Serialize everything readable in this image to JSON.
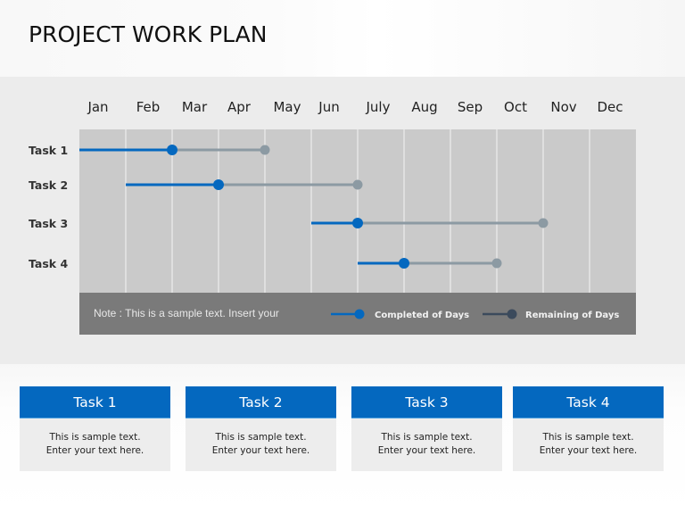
{
  "header": {
    "title": "PROJECT WORK PLAN"
  },
  "colors": {
    "completed": "#0468bf",
    "remaining": "#8c9aa3",
    "remaining_legend": "#3b4a5c",
    "plot_bg": "#cacaca",
    "grid": "#e6e6e6",
    "footer_bg": "#7a7a7a",
    "card_header": "#0468bf"
  },
  "chart_data": {
    "type": "gantt",
    "title": "",
    "xlabel": "",
    "ylabel": "",
    "x_unit": "months from start of Jan",
    "xlim": [
      0,
      12
    ],
    "grid": true,
    "categories_x": [
      "Jan",
      "Feb",
      "Mar",
      "Apr",
      "May",
      "Jun",
      "July",
      "Aug",
      "Sep",
      "Oct",
      "Nov",
      "Dec"
    ],
    "tasks": [
      {
        "name": "Task 1",
        "start": 0,
        "progress": 2,
        "end": 4
      },
      {
        "name": "Task 2",
        "start": 1,
        "progress": 3,
        "end": 6
      },
      {
        "name": "Task 3",
        "start": 5,
        "progress": 6,
        "end": 10
      },
      {
        "name": "Task 4",
        "start": 6,
        "progress": 7,
        "end": 9
      }
    ],
    "legend": [
      {
        "label": "Completed of Days",
        "series": "completed"
      },
      {
        "label": "Remaining of Days",
        "series": "remaining"
      }
    ],
    "legend_position": "bottom-right",
    "note": "Note : This is a sample text. Insert your"
  },
  "cards": [
    {
      "title": "Task 1",
      "line1": "This is sample text.",
      "line2": "Enter your text here."
    },
    {
      "title": "Task 2",
      "line1": "This is sample text.",
      "line2": "Enter your text here."
    },
    {
      "title": "Task 3",
      "line1": "This is sample text.",
      "line2": "Enter your text here."
    },
    {
      "title": "Task 4",
      "line1": "This is sample text.",
      "line2": "Enter your text here."
    }
  ]
}
